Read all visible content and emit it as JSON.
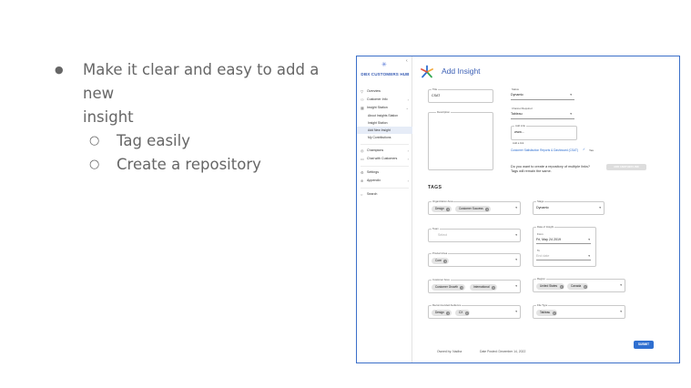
{
  "slide": {
    "bullets": [
      {
        "text": "Make it clear and easy to add a new",
        "text2": "insight",
        "children": [
          "Tag easily",
          "Create a repository"
        ]
      }
    ]
  },
  "app": {
    "brand": "DBX CUSTOMERS HUB",
    "nav": {
      "overview": "Overview",
      "customer_info": "Customer Info",
      "insight_station": "Insight Station",
      "sub": [
        "About Insights Station",
        "Insight Station",
        "Add New Insight",
        "My Contributions"
      ],
      "champions": "Champions",
      "chat": "Chat with Customers",
      "settings": "Settings",
      "appendix": "Appendix",
      "search": "Search"
    },
    "page_title": "Add Insight",
    "form": {
      "title_label": "Title",
      "title_value": "CSAT",
      "status_label": "Status",
      "status_value": "Dynamic",
      "description_label": "Description",
      "channel_label": "Channel Required",
      "channel_value": "Tableau",
      "addlink_label": "Add Link",
      "addlink_value": "www...",
      "addlink_helper": "Add a link",
      "report_link": "Customer Satisfaction Reports & Dashboard (CSAT)",
      "check_label": "Yes",
      "repo_question": "Do you want to create a repository of multiple links? Tags will remain the same.",
      "repo_button": "ADD ANOTHER LINK"
    },
    "tags_heading": "TAGS",
    "tags": {
      "org_area_label": "Organization Area",
      "org_area_chips": [
        "Design",
        "Customer Success"
      ],
      "stage_label": "Stage",
      "stage_value": "Dynamic",
      "team_label": "Team",
      "team_placeholder": "Select",
      "date_label": "Date of Insight",
      "from_label": "From",
      "from_value": "Fri, May 24 2019",
      "to_label": "To",
      "to_placeholder": "End date",
      "product_area_label": "Product Area",
      "product_area_chips": [
        "Core"
      ],
      "customer_area_label": "Customer Area",
      "customer_area_chips": [
        "Customer Growth",
        "International"
      ],
      "region_label": "Region",
      "region_chips": [
        "United States",
        "Canada"
      ],
      "audience_label": "Recommended Audience",
      "audience_chips": [
        "Design",
        "CX"
      ],
      "file_type_label": "File Type",
      "file_type_chips": [
        "Tableau"
      ]
    },
    "submit": "SUBMIT",
    "footer": {
      "owner": "Owned by: Nadha",
      "date": "Date Posted: December 14, 2022"
    }
  }
}
